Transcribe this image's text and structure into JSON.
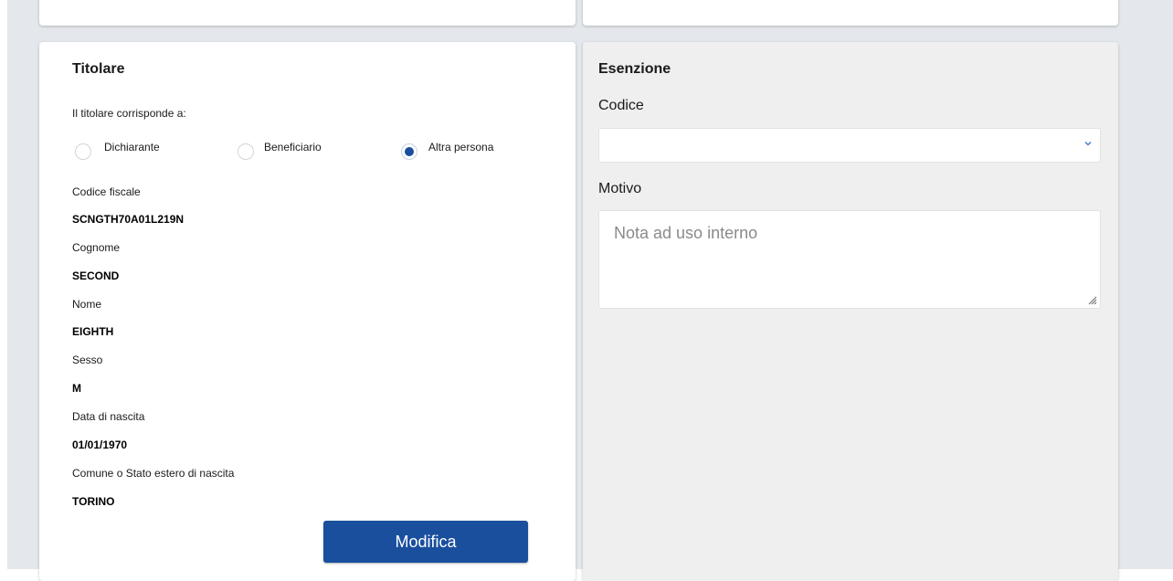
{
  "titolare": {
    "title": "Titolare",
    "question": "Il titolare corrisponde a:",
    "options": [
      "Dichiarante",
      "Beneficiario",
      "Altra persona"
    ],
    "selected": "Altra persona",
    "fields": [
      {
        "label": "Codice fiscale",
        "value": "SCNGTH70A01L219N"
      },
      {
        "label": "Cognome",
        "value": "SECOND"
      },
      {
        "label": "Nome",
        "value": "EIGHTH"
      },
      {
        "label": "Sesso",
        "value": "M"
      },
      {
        "label": "Data di nascita",
        "value": "01/01/1970"
      },
      {
        "label": "Comune o Stato estero di nascita",
        "value": "TORINO"
      }
    ],
    "edit_button": "Modifica"
  },
  "esenzione": {
    "title": "Esenzione",
    "codice_label": "Codice",
    "codice_value": "",
    "motivo_label": "Motivo",
    "motivo_placeholder": "Nota ad uso interno"
  },
  "colors": {
    "primary": "#1a4f9e",
    "page_bg": "#e4e8ec",
    "card_grey": "#efefef",
    "card_white": "#ffffff"
  },
  "icons": {
    "select_arrow": "chevron-down-icon",
    "resize_grip": "resize-grip-icon"
  }
}
